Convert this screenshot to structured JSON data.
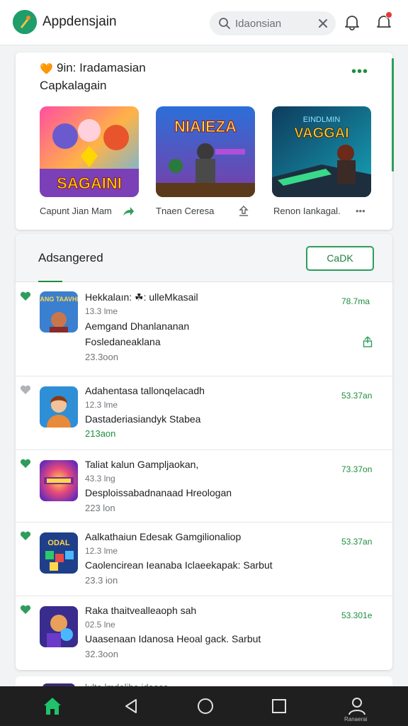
{
  "header": {
    "app_name": "Appdensjain",
    "search_placeholder": "Idaonsian",
    "logo_icon": "app-logo",
    "colors": {
      "brand": "#1f9d6b",
      "accent": "#1e8e3e",
      "badge": "#e53935"
    }
  },
  "featured": {
    "emoji": "🧡",
    "title": "9in: Iradamasian",
    "subtitle": "Capkalagain",
    "more_icon": "more-dots-icon",
    "tiles": [
      {
        "art_text": "SAGAINI",
        "label": "Capunt Jian Mam",
        "action_icon": "share-icon"
      },
      {
        "art_text": "NIAIEZA",
        "label": "Tnaen Ceresa",
        "action_icon": "download-icon"
      },
      {
        "art_text": "VAGGAI",
        "art_subtext": "EINDLMIN",
        "label": "Renon Iankagal.",
        "action_icon": "more-icon"
      }
    ]
  },
  "list": {
    "title": "Adsangered",
    "button_label": "CaDK",
    "items": [
      {
        "title": "Hekkalaın: ☘: ulleMkasail",
        "size": "13.3 lme",
        "desc1": "Aemgand Dhanlananan",
        "desc2": "Fosledaneaklana",
        "downloads": "23.3oon",
        "rating": "78.7ma",
        "liked": true,
        "action_icon": "share-up-icon",
        "icon_art": "TANG TAAVHE"
      },
      {
        "title": "Adahentasa tallonqelacadh",
        "size": "12.3 lme",
        "desc1": "Dastaderiasiandyk Stabea",
        "downloads": "213aon",
        "rating": "53.37an",
        "liked": false,
        "action_icon": "",
        "icon_art": ""
      },
      {
        "title": "Taliat kalun Gampljaokan,",
        "size": "43.3 lng",
        "desc1": "Desploissabadnanaad Hreologan",
        "downloads": "223 lon",
        "rating": "73.37on",
        "liked": true,
        "action_icon": "",
        "icon_art": ""
      },
      {
        "title": "Aalkathaiun Edesak Gamgilionaliop",
        "size": "12.3 lme",
        "desc1": "Caolencirean Ieanaba Iclaeekapak: Sarbut",
        "downloads": "23.3 ion",
        "rating": "53.37an",
        "liked": true,
        "action_icon": "",
        "icon_art": "ODAL"
      },
      {
        "title": "Raka thaitvealleaoph sah",
        "size": "02.5 lne",
        "desc1": "Uaasenaan Idanosa Heoal gack. Sarbut",
        "downloads": "32.3oon",
        "rating": "53.301e",
        "liked": true,
        "action_icon": "",
        "icon_art": ""
      }
    ],
    "partial_text": "lulta lmdalihe idaasa"
  },
  "nav": {
    "items": [
      "home-icon",
      "back-icon",
      "home-circle-icon",
      "recents-icon",
      "profile-icon"
    ],
    "profile_label": "Ranaerai"
  }
}
